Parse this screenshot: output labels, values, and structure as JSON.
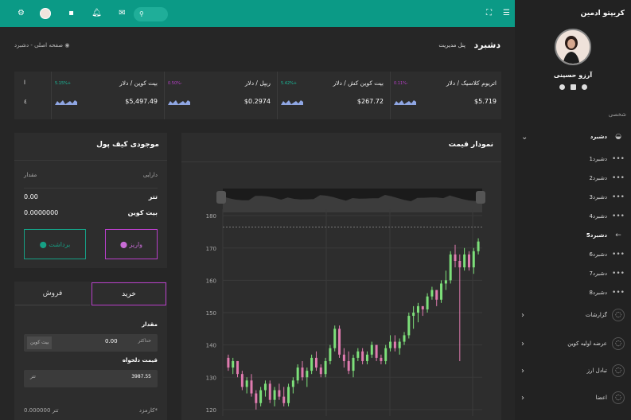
{
  "app": {
    "brand": "کریپتو ادمین"
  },
  "user": {
    "name": "آرزو حسینی"
  },
  "sidebar": {
    "section": "شخصی",
    "items": [
      {
        "label": "دشبرد",
        "bold": true
      },
      {
        "label": "دشبرد1"
      },
      {
        "label": "دشبرد2"
      },
      {
        "label": "دشبرد3"
      },
      {
        "label": "دشبرد4"
      },
      {
        "label": "دشبرد5",
        "active": true
      },
      {
        "label": "دشبرد6"
      },
      {
        "label": "دشبرد7"
      },
      {
        "label": "دشبرد8"
      },
      {
        "label": "گزارشات"
      },
      {
        "label": "عرضه اولیه کوین"
      },
      {
        "label": "تبادل ارز"
      },
      {
        "label": "اعضا"
      }
    ]
  },
  "page": {
    "title": "دشبرد",
    "subtitle": "پنل مدیریت",
    "breadcrumb_home": "صفحه اصلی",
    "breadcrumb_sep": "-",
    "breadcrumb_current": "دشبرد"
  },
  "tickers": [
    {
      "name": "اتریوم کلاسیک / دلار",
      "pct": "-0.11%",
      "price": "$5.719",
      "color": "#b83fc9"
    },
    {
      "name": "بیت کوین کش / دلار",
      "pct": "+5.42%",
      "price": "$267.72",
      "color": "#1abc9c"
    },
    {
      "name": "ریپل / دلار",
      "pct": "-0.50%",
      "price": "$0.2974",
      "color": "#b83fc9"
    },
    {
      "name": "بیت کوین / دلار",
      "pct": "+5.15%",
      "price": "$5,497.49",
      "color": "#1abc9c"
    }
  ],
  "ticker_partial": {
    "name": "ا",
    "price": "٤"
  },
  "wallet": {
    "title": "موجودی کیف پول",
    "col_asset": "دارایی",
    "col_amount": "مقدار",
    "rows": [
      {
        "asset": "تتر",
        "amount": "0.00"
      },
      {
        "asset": "بیت کوین",
        "amount": "0.0000000"
      }
    ],
    "deposit": "واریز",
    "withdraw": "برداشت"
  },
  "trade": {
    "buy": "خرید",
    "sell": "فروش",
    "amount_label": "مقدار",
    "max_label": "حداکثر",
    "amount_value": "0.00",
    "amount_unit": "بیت کوین",
    "price_label": "قیمت دلخواه",
    "price_value": "3987.55",
    "price_unit": "تتر",
    "fee_label": "کارمزد*",
    "fee_value": "0.000000 تتر"
  },
  "chart_data": {
    "type": "candlestick",
    "title": "نمودار قیمت",
    "ylim": [
      118,
      182
    ],
    "yticks": [
      "120",
      "130",
      "140",
      "150",
      "160",
      "170",
      "180"
    ],
    "candles": [
      {
        "o": 136,
        "h": 137,
        "l": 132,
        "c": 133
      },
      {
        "o": 133,
        "h": 136,
        "l": 131,
        "c": 135
      },
      {
        "o": 135,
        "h": 135,
        "l": 130,
        "c": 131
      },
      {
        "o": 131,
        "h": 132,
        "l": 126,
        "c": 127
      },
      {
        "o": 127,
        "h": 130,
        "l": 125,
        "c": 129
      },
      {
        "o": 129,
        "h": 131,
        "l": 124,
        "c": 125
      },
      {
        "o": 125,
        "h": 126,
        "l": 120,
        "c": 122
      },
      {
        "o": 122,
        "h": 127,
        "l": 121,
        "c": 126
      },
      {
        "o": 126,
        "h": 129,
        "l": 124,
        "c": 128
      },
      {
        "o": 128,
        "h": 129,
        "l": 122,
        "c": 123
      },
      {
        "o": 123,
        "h": 127,
        "l": 121,
        "c": 126
      },
      {
        "o": 126,
        "h": 128,
        "l": 123,
        "c": 124
      },
      {
        "o": 124,
        "h": 127,
        "l": 121,
        "c": 122
      },
      {
        "o": 122,
        "h": 128,
        "l": 121,
        "c": 127
      },
      {
        "o": 127,
        "h": 130,
        "l": 125,
        "c": 129
      },
      {
        "o": 129,
        "h": 134,
        "l": 128,
        "c": 133
      },
      {
        "o": 133,
        "h": 135,
        "l": 129,
        "c": 130
      },
      {
        "o": 130,
        "h": 133,
        "l": 127,
        "c": 132
      },
      {
        "o": 132,
        "h": 137,
        "l": 131,
        "c": 136
      },
      {
        "o": 136,
        "h": 138,
        "l": 132,
        "c": 133
      },
      {
        "o": 133,
        "h": 134,
        "l": 130,
        "c": 131
      },
      {
        "o": 131,
        "h": 136,
        "l": 130,
        "c": 135
      },
      {
        "o": 135,
        "h": 140,
        "l": 134,
        "c": 139
      },
      {
        "o": 139,
        "h": 146,
        "l": 138,
        "c": 145
      },
      {
        "o": 145,
        "h": 146,
        "l": 136,
        "c": 137
      },
      {
        "o": 137,
        "h": 139,
        "l": 133,
        "c": 135
      },
      {
        "o": 135,
        "h": 138,
        "l": 131,
        "c": 132
      },
      {
        "o": 132,
        "h": 137,
        "l": 130,
        "c": 136
      },
      {
        "o": 136,
        "h": 139,
        "l": 135,
        "c": 138
      },
      {
        "o": 138,
        "h": 139,
        "l": 134,
        "c": 135
      },
      {
        "o": 135,
        "h": 138,
        "l": 134,
        "c": 137
      },
      {
        "o": 137,
        "h": 141,
        "l": 136,
        "c": 140
      },
      {
        "o": 140,
        "h": 140,
        "l": 135,
        "c": 136
      },
      {
        "o": 136,
        "h": 137,
        "l": 134,
        "c": 135
      },
      {
        "o": 135,
        "h": 140,
        "l": 134,
        "c": 139
      },
      {
        "o": 139,
        "h": 143,
        "l": 138,
        "c": 141
      },
      {
        "o": 141,
        "h": 143,
        "l": 138,
        "c": 139
      },
      {
        "o": 139,
        "h": 142,
        "l": 137,
        "c": 141
      },
      {
        "o": 141,
        "h": 144,
        "l": 140,
        "c": 143
      },
      {
        "o": 143,
        "h": 150,
        "l": 142,
        "c": 149
      },
      {
        "o": 149,
        "h": 152,
        "l": 145,
        "c": 150
      },
      {
        "o": 150,
        "h": 153,
        "l": 147,
        "c": 152
      },
      {
        "o": 152,
        "h": 152,
        "l": 149,
        "c": 151
      },
      {
        "o": 151,
        "h": 156,
        "l": 150,
        "c": 155
      },
      {
        "o": 155,
        "h": 158,
        "l": 154,
        "c": 157
      },
      {
        "o": 157,
        "h": 157,
        "l": 152,
        "c": 154
      },
      {
        "o": 154,
        "h": 160,
        "l": 153,
        "c": 159
      },
      {
        "o": 159,
        "h": 163,
        "l": 157,
        "c": 160
      },
      {
        "o": 160,
        "h": 169,
        "l": 159,
        "c": 168
      },
      {
        "o": 168,
        "h": 171,
        "l": 164,
        "c": 166
      },
      {
        "o": 166,
        "h": 168,
        "l": 135,
        "c": 164
      },
      {
        "o": 164,
        "h": 170,
        "l": 163,
        "c": 168
      },
      {
        "o": 168,
        "h": 169,
        "l": 163,
        "c": 164
      },
      {
        "o": 164,
        "h": 170,
        "l": 162,
        "c": 169
      },
      {
        "o": 169,
        "h": 173,
        "l": 168,
        "c": 172
      }
    ]
  }
}
